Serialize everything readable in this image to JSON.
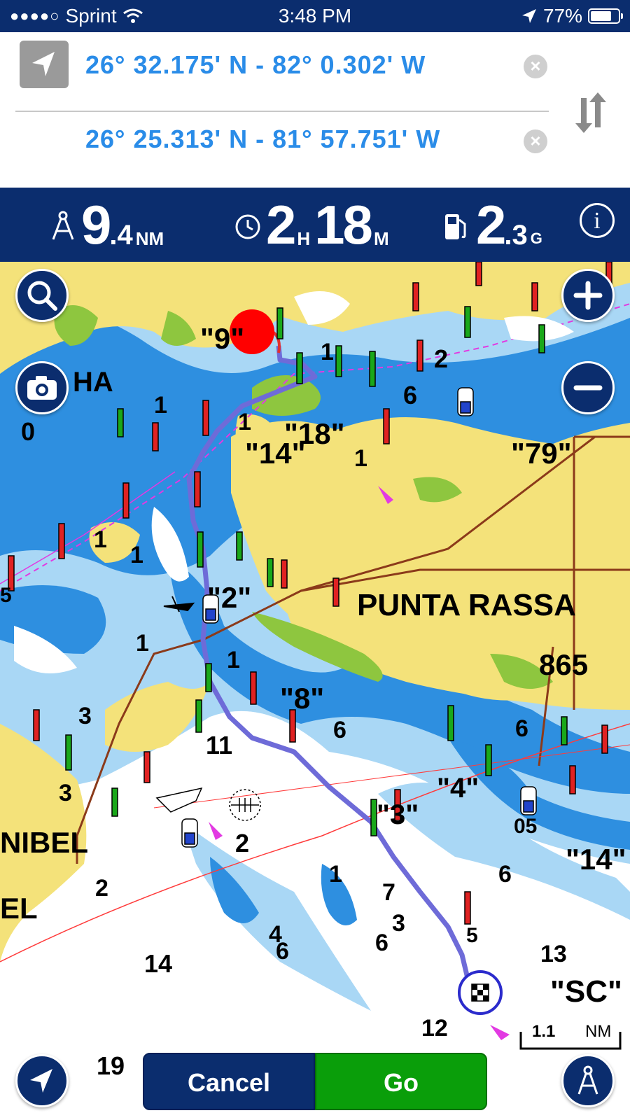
{
  "status_bar": {
    "carrier": "Sprint",
    "signal_dots": "●●●●○",
    "time": "3:48 PM",
    "battery": "77%",
    "battery_level": 0.77
  },
  "route": {
    "start_coord": "26° 32.175' N - 82° 0.302' W",
    "end_coord": "26° 25.313' N - 81° 57.751' W",
    "clear_glyph": "×"
  },
  "stats": {
    "distance_whole": "9",
    "distance_fraction": ".4",
    "distance_unit": "NM",
    "time_hours": "2",
    "time_hours_unit": "H",
    "time_minutes": "18",
    "time_minutes_unit": "M",
    "fuel_whole": "2",
    "fuel_fraction": ".3",
    "fuel_unit": "G",
    "info_glyph": "i"
  },
  "map": {
    "place_label": "PUNTA RASSA",
    "labels": {
      "l9": "\"9\"",
      "l18": "\"18\"",
      "l14": "\"14\"",
      "l79": "\"79\"",
      "l2q": "\"2\"",
      "l8": "\"8\"",
      "l4": "\"4\"",
      "l3q": "\"3\"",
      "l14b": "\"14\"",
      "lsc": "\"SC\"",
      "lnibel": "NIBEL",
      "lha": "HA",
      "lel": "EL",
      "l865": "865",
      "ld0": "0",
      "ld3": "3",
      "ld1": "1",
      "ld1b": "1",
      "ld1c": "1",
      "ld1d": "1",
      "ld1e": "1",
      "ld1f": "1",
      "ld1g": "1",
      "ld1h": "1",
      "ld1i": "1",
      "ld2": "2",
      "ld2b": "2",
      "ld2c": "2",
      "ld3b": "3",
      "ld3c": "3",
      "ld4": "4",
      "ld6": "6",
      "ld6b": "6",
      "ld6c": "6",
      "ld6d": "6",
      "ld6e": "6",
      "ld7": "7",
      "ld11": "11",
      "ld12": "12",
      "ld13": "13",
      "ld14": "14",
      "ld15": "5",
      "ld19": "19",
      "ld5": "5",
      "ld05": "05",
      "ld61": "6"
    },
    "scale_value": "1.1",
    "scale_unit": "NM"
  },
  "actions": {
    "cancel_label": "Cancel",
    "go_label": "Go"
  },
  "colors": {
    "header_navy": "#0b2d6e",
    "coord_blue": "#2a8ce8",
    "land_yellow": "#f4e27a",
    "deep_water": "#2e8fe0",
    "shallow_water": "#a9d7f5",
    "route_purple": "#6e6bd8",
    "go_green": "#0a9e0a",
    "start_red": "#ff0000"
  }
}
